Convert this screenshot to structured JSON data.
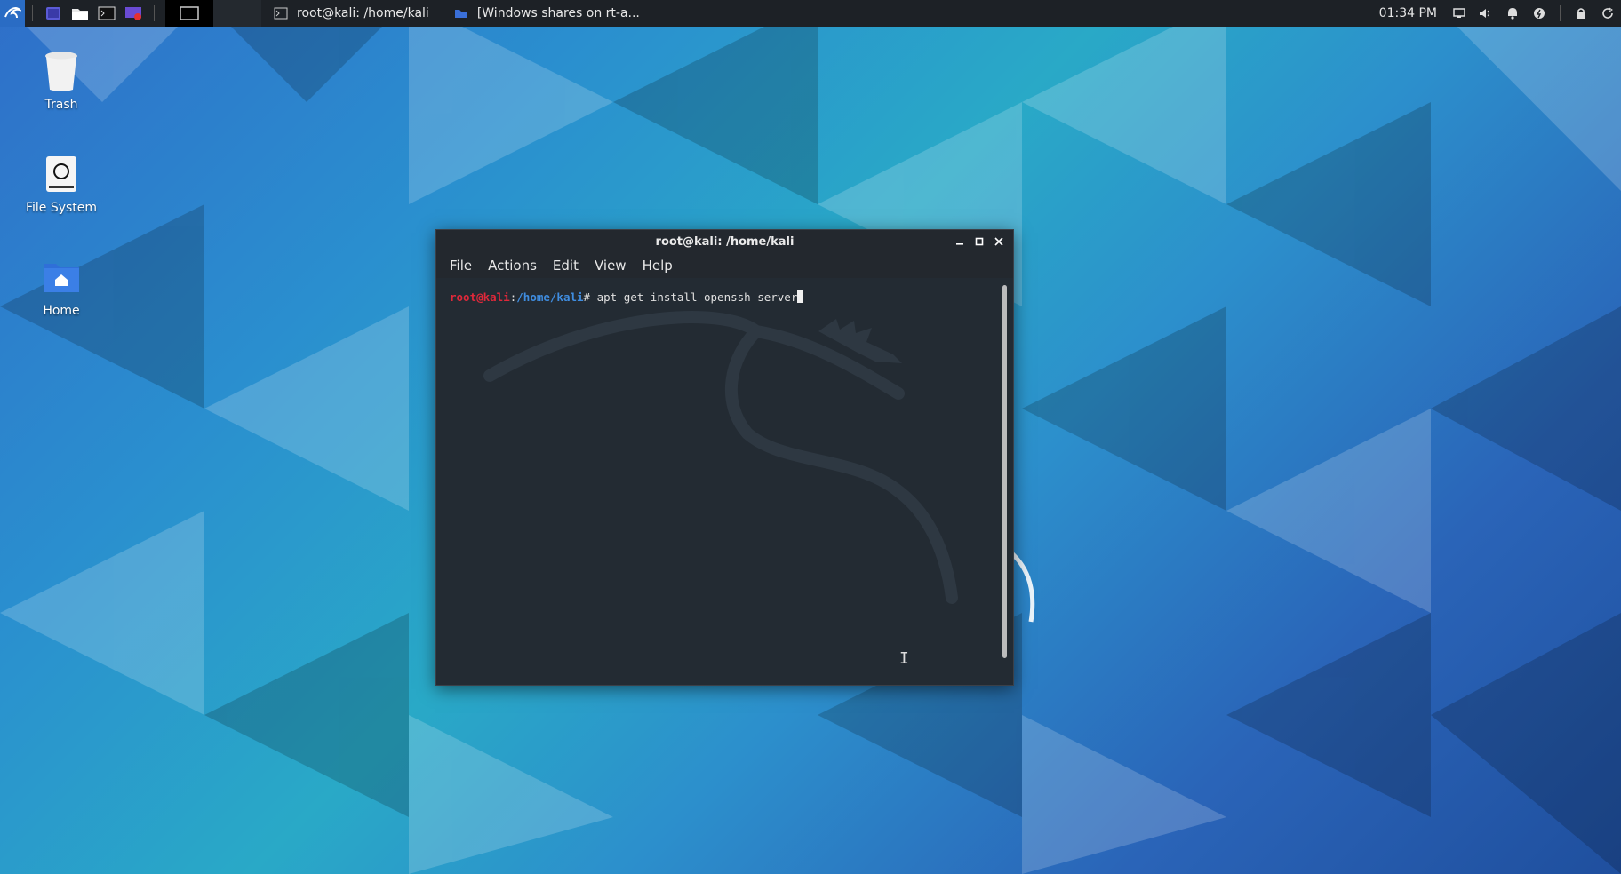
{
  "panel": {
    "tasks": [
      {
        "label": "root@kali: /home/kali",
        "icon": "terminal-icon"
      },
      {
        "label": "[Windows shares on rt-a...",
        "icon": "folder-icon"
      }
    ],
    "clock": "01:34 PM"
  },
  "desktop": {
    "icons": [
      {
        "label": "Trash",
        "icon": "trash-icon"
      },
      {
        "label": "File System",
        "icon": "drive-icon"
      },
      {
        "label": "Home",
        "icon": "home-folder-icon"
      }
    ]
  },
  "terminal": {
    "title": "root@kali: /home/kali",
    "menu": [
      "File",
      "Actions",
      "Edit",
      "View",
      "Help"
    ],
    "prompt_user": "root@kali",
    "prompt_sep": ":",
    "prompt_path": "/home/kali",
    "prompt_symbol": "# ",
    "command": "apt-get install openssh-server"
  },
  "colors": {
    "panel_bg": "#1d2126",
    "terminal_bg": "#232b33",
    "prompt_user": "#e0283a",
    "prompt_path": "#3f8de0"
  }
}
